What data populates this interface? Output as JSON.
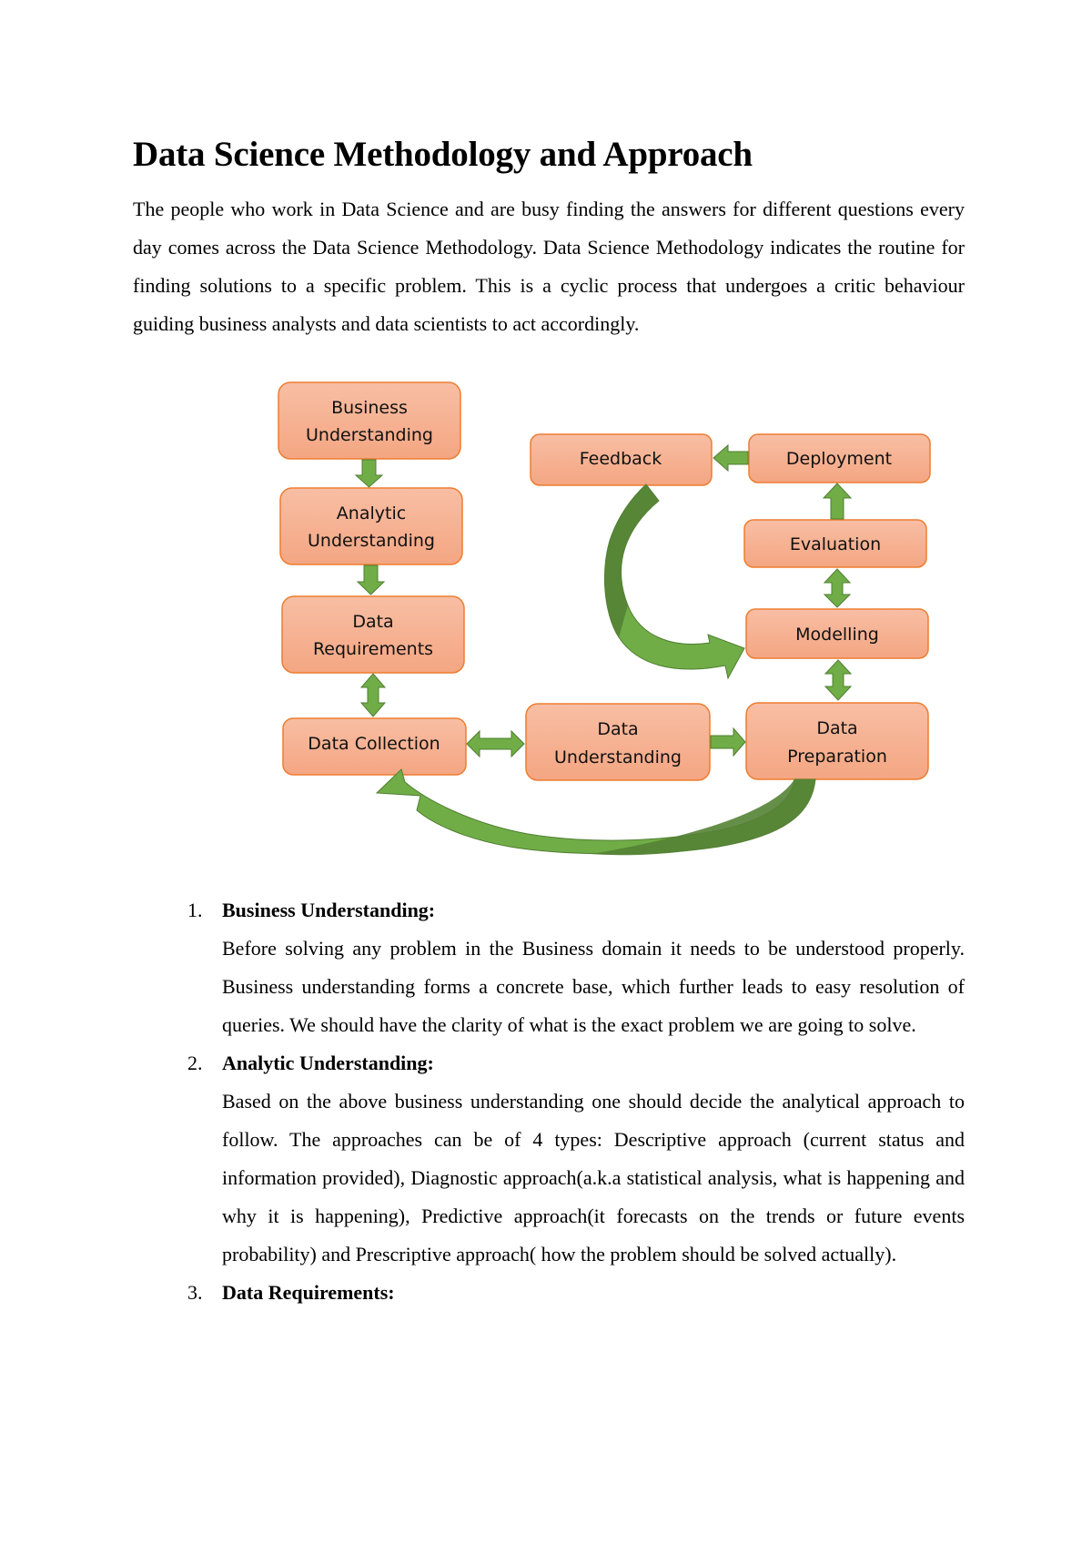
{
  "title": "Data Science Methodology and Approach",
  "intro": "The people who work in Data Science and are busy finding the answers for different questions every day comes across the Data Science Methodology. Data Science Methodology indicates the routine for finding solutions to a specific problem. This is a cyclic process that undergoes a critic behaviour guiding business analysts and data scientists to act accordingly.",
  "diagram": {
    "colors": {
      "box_fill_top": "#F8BEA4",
      "box_fill_bottom": "#F4A682",
      "box_border": "#ED7D31",
      "arrow_fill": "#70AD47",
      "arrow_dark": "#548235",
      "arrow_border": "#507E32"
    },
    "boxes": {
      "business_understanding": [
        "Business",
        "Understanding"
      ],
      "analytic_understanding": [
        "Analytic",
        "Understanding"
      ],
      "data_requirements": [
        "Data",
        "Requirements"
      ],
      "data_collection": [
        "Data Collection"
      ],
      "data_understanding": [
        "Data",
        "Understanding"
      ],
      "data_preparation": [
        "Data",
        "Preparation"
      ],
      "modelling": [
        "Modelling"
      ],
      "evaluation": [
        "Evaluation"
      ],
      "deployment": [
        "Deployment"
      ],
      "feedback": [
        "Feedback"
      ]
    }
  },
  "sections": [
    {
      "number": "1.",
      "heading": "Business Understanding:",
      "body": "Before solving any problem in the Business domain it needs to be understood properly. Business understanding forms a concrete base, which further leads to easy resolution of queries. We should have the clarity of what is the exact problem we are going to solve."
    },
    {
      "number": "2.",
      "heading": "Analytic Understanding:",
      "body": "Based on the above business understanding one should decide the analytical approach to follow. The approaches can be of 4 types: Descriptive approach (current status and information provided), Diagnostic approach(a.k.a statistical analysis, what is happening and why it is happening), Predictive approach(it forecasts on the trends or future events probability) and Prescriptive approach( how the problem should be solved actually)."
    },
    {
      "number": "3.",
      "heading": "Data Requirements:",
      "body": ""
    }
  ]
}
